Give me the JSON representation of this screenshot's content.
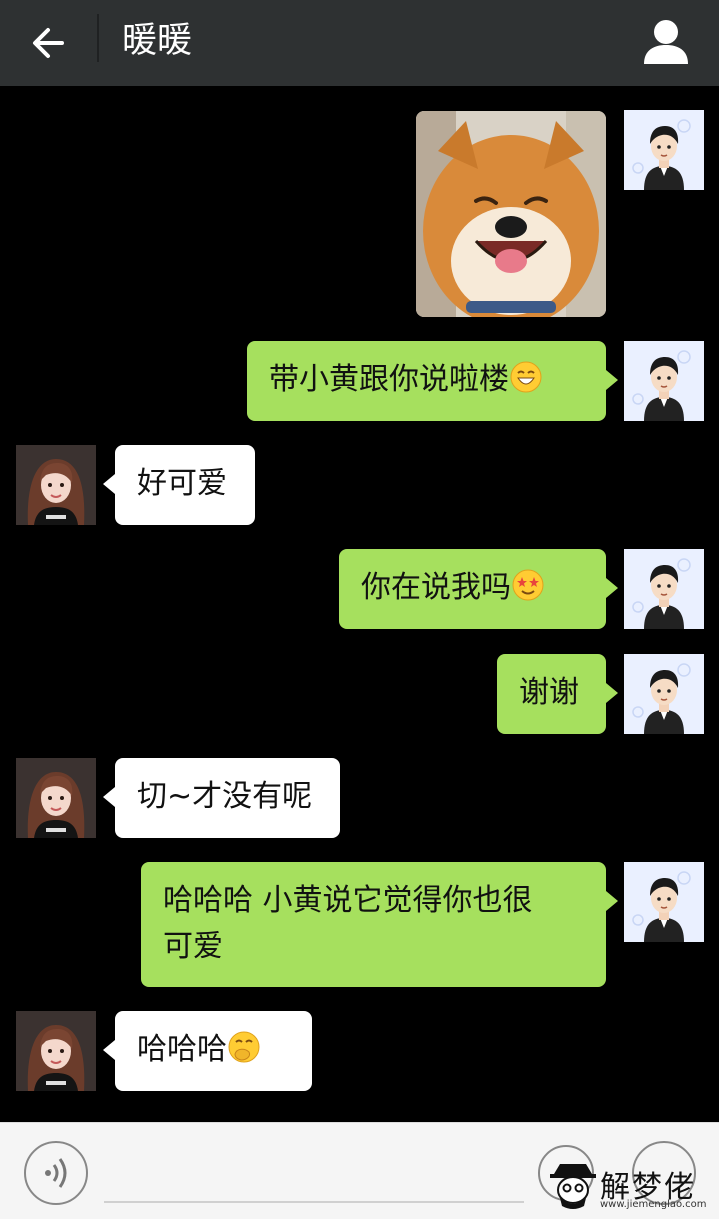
{
  "header": {
    "title": "暖暖",
    "back_icon": "arrow-left-icon",
    "profile_icon": "person-icon",
    "background": "#2e3132"
  },
  "colors": {
    "outgoing_bubble": "#a6e05e",
    "incoming_bubble": "#ffffff",
    "chat_background": "#000000"
  },
  "messages": [
    {
      "side": "out",
      "type": "image",
      "content": "shiba-dog-photo"
    },
    {
      "side": "out",
      "type": "text",
      "text": "带小黄跟你说啦楼",
      "emoji": "grinning-face-icon"
    },
    {
      "side": "in",
      "type": "text",
      "text": "好可爱"
    },
    {
      "side": "out",
      "type": "text",
      "text": "你在说我吗",
      "emoji": "star-eyes-face-icon"
    },
    {
      "side": "out",
      "type": "text",
      "text": "谢谢"
    },
    {
      "side": "in",
      "type": "text",
      "text": "切~才没有呢"
    },
    {
      "side": "out",
      "type": "text",
      "text": "哈哈哈 小黄说它觉得你也很可爱"
    },
    {
      "side": "in",
      "type": "text",
      "text": "哈哈哈",
      "emoji": "hand-over-mouth-face-icon"
    }
  ],
  "input_bar": {
    "voice_icon": "voice-icon",
    "placeholder": "",
    "emoji_icon": "emoji-icon",
    "plus_icon": "plus-icon"
  },
  "watermark": {
    "text": "解梦佬",
    "url": "www.jiemenglao.com"
  }
}
